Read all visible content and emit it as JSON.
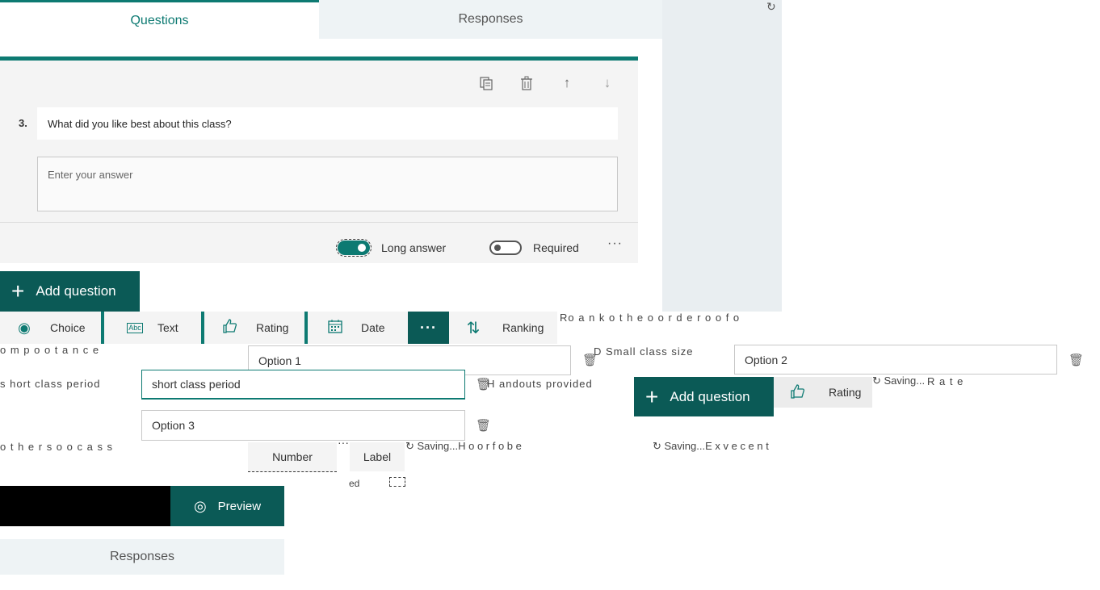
{
  "tabs": {
    "questions": "Questions",
    "responses": "Responses"
  },
  "toolbar": {
    "copy_icon": "copy-icon",
    "delete_icon": "trash-icon",
    "up_icon": "arrow-up-icon",
    "down_icon": "arrow-down-icon"
  },
  "question": {
    "number": "3.",
    "title": "What did you like best about this class?",
    "answer_placeholder": "Enter your answer",
    "long_answer_label": "Long answer",
    "required_label": "Required",
    "more": "···"
  },
  "add_question": "Add question",
  "types": {
    "choice": "Choice",
    "text": "Text",
    "rating": "Rating",
    "date": "Date",
    "more": "···",
    "ranking": "Ranking"
  },
  "options": {
    "option1": "Option 1",
    "option2": "Option 2",
    "option3": "Option 3",
    "active_value": "short class period"
  },
  "artifacts": {
    "row1": "Ro a n k o t h e o o r d e r o o f o",
    "row2": "o m p o o t a n c e",
    "small_class": "D  Small class size",
    "short_left": "s    hort class period",
    "handouts": "H    andouts provided",
    "row3_right": "R   a t e",
    "row4": "o t h e r s o o c a s s",
    "saving": "Saving...",
    "saving_h": "Saving...H o o r f o b e",
    "saving_e": "Saving...E x v e c e n t",
    "partial": "ed"
  },
  "number_label": "Number",
  "label_label": "Label",
  "preview": "Preview",
  "responses_bottom": "Responses",
  "rating2": "Rating",
  "colors": {
    "accent": "#0d7a72",
    "dark_accent": "#0b5a56",
    "panel_gray": "#e9eef1"
  }
}
